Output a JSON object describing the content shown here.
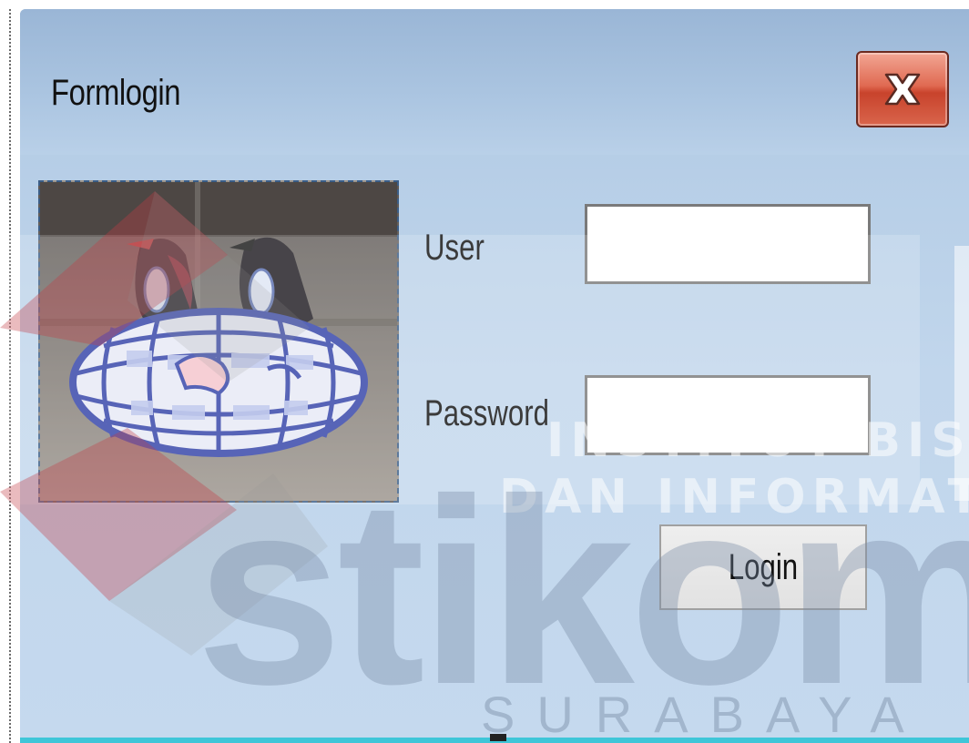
{
  "window": {
    "title": "Formlogin",
    "close_icon": "close-x-icon"
  },
  "form": {
    "user_label": "User",
    "user_value": "",
    "password_label": "Password",
    "password_value": "",
    "login_label": "Login"
  },
  "logo_picture": {
    "icon": "globe-birds-logo-picture"
  },
  "watermark": {
    "line1": "INSTITUT BISNIS",
    "line2": "DAN INFORMATIKA",
    "brand": "stikom",
    "city": "SURABAYA"
  },
  "colors": {
    "titlebar": "#9ab6d6",
    "close_button": "#d9583f",
    "window_body": "#c1d6ec"
  }
}
